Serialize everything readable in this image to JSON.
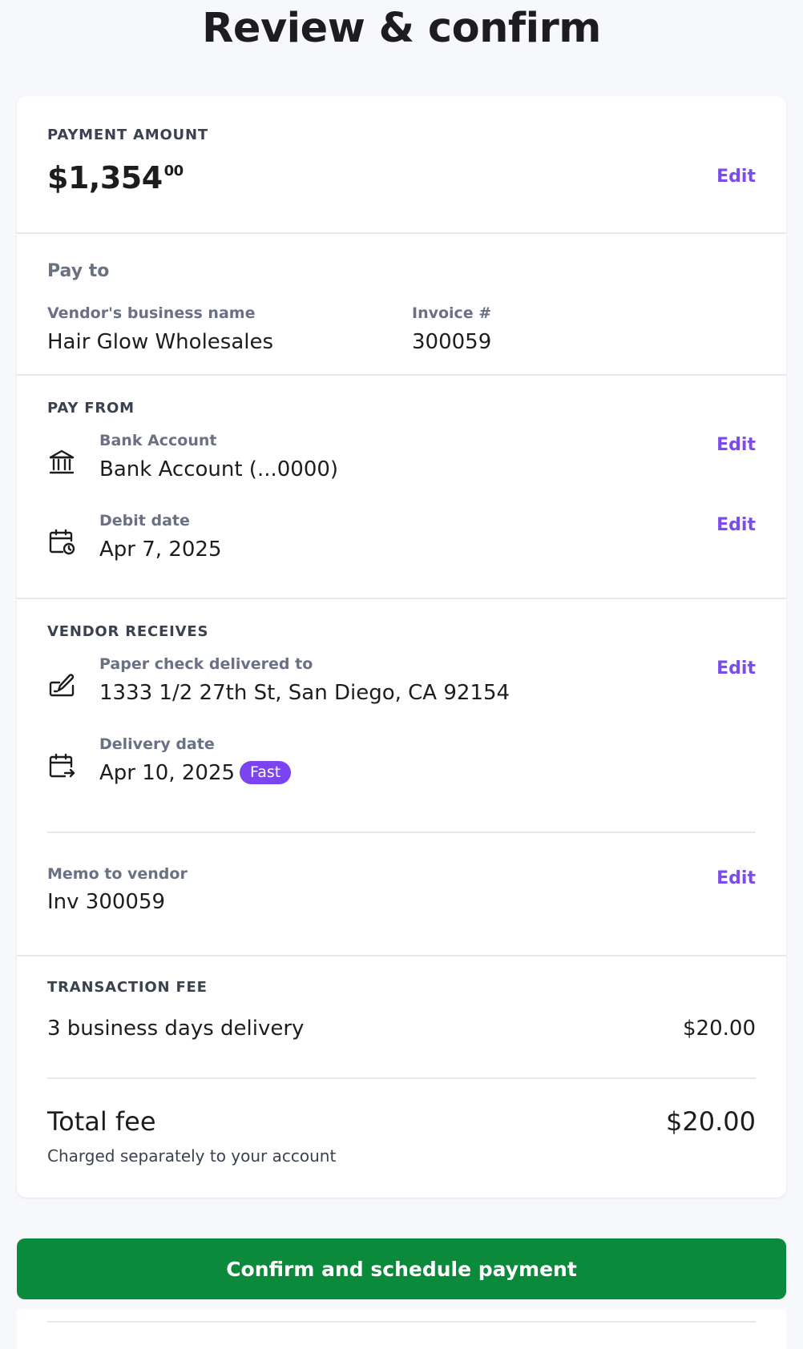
{
  "page": {
    "title": "Review & confirm"
  },
  "payment_amount": {
    "overline": "PAYMENT AMOUNT",
    "dollars": "$1,354",
    "cents": "00",
    "edit_label": "Edit"
  },
  "pay_to": {
    "heading": "Pay to",
    "vendor_label": "Vendor's business name",
    "vendor_value": "Hair Glow Wholesales",
    "invoice_label": "Invoice #",
    "invoice_value": "300059"
  },
  "pay_from": {
    "overline": "PAY FROM",
    "bank_label": "Bank Account",
    "bank_value": "Bank Account (...0000)",
    "bank_icon": "bank-icon",
    "bank_edit": "Edit",
    "debit_label": "Debit date",
    "debit_value": "Apr 7, 2025",
    "debit_icon": "calendar-clock-icon",
    "debit_edit": "Edit"
  },
  "vendor_receives": {
    "overline": "VENDOR RECEIVES",
    "check_label": "Paper check delivered to",
    "check_value": "1333 1/2 27th St, San Diego, CA 92154",
    "check_icon": "check-sign-icon",
    "check_edit": "Edit",
    "delivery_label": "Delivery date",
    "delivery_value": "Apr 10, 2025",
    "delivery_icon": "calendar-arrow-icon",
    "delivery_badge": "Fast",
    "memo_label": "Memo to vendor",
    "memo_value": "Inv 300059",
    "memo_edit": "Edit"
  },
  "transaction_fee": {
    "overline": "TRANSACTION FEE",
    "line_label": "3 business days delivery",
    "line_amount": "$20.00",
    "total_label": "Total fee",
    "total_amount": "$20.00",
    "total_note": "Charged separately to your account"
  },
  "cta": {
    "label": "Confirm and schedule payment"
  },
  "colors": {
    "accent": "#7b4af0",
    "badge": "#7a45f0",
    "cta": "#0a8a3a",
    "background": "#f7f8fb"
  }
}
